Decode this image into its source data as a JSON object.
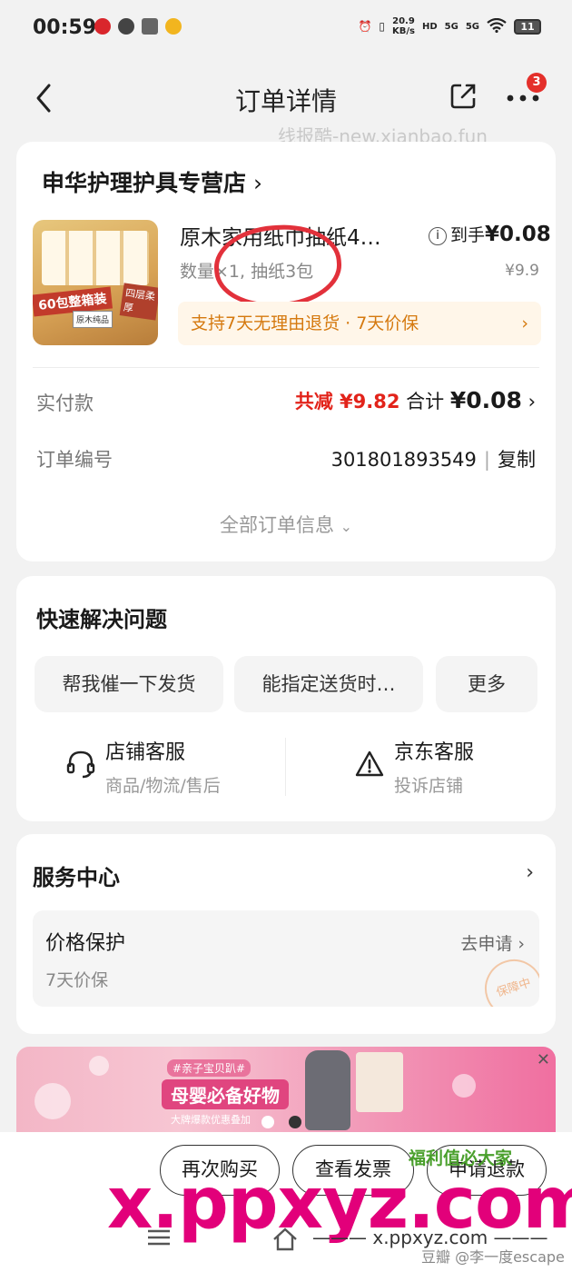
{
  "status_bar": {
    "time": "00:59",
    "net_speed": "20.9\nKB/s",
    "hd": "HD",
    "sig1": "5G",
    "sig2": "5G",
    "battery": "11"
  },
  "nav": {
    "title": "订单详情",
    "badge_count": "3"
  },
  "top_watermark": "线报酷-new.xianbao.fun",
  "order": {
    "store_name": "申华护理护具专营店",
    "product_name": "原木家用纸巾抽纸4…",
    "product_spec": "数量×1, 抽纸3包",
    "image_text": {
      "tag": "60包整箱装",
      "tag2": "四层柔厚",
      "logo": "原木纯品"
    },
    "price_label": "到手",
    "price_final": "¥0.08",
    "price_orig": "¥9.9",
    "promise": "支持7天无理由退货 · 7天价保",
    "pay_label": "实付款",
    "reduce": "共减 ¥9.82",
    "total_label": "合计",
    "total": "¥0.08",
    "order_no_label": "订单编号",
    "order_no": "301801893549",
    "copy": "复制",
    "all_info": "全部订单信息"
  },
  "quick": {
    "title": "快速解决问题",
    "buttons": [
      "帮我催一下发货",
      "能指定送货时…",
      "更多"
    ],
    "store_cs": {
      "title": "店铺客服",
      "sub": "商品/物流/售后"
    },
    "jd_cs": {
      "title": "京东客服",
      "sub": "投诉店铺"
    }
  },
  "service": {
    "title": "服务中心",
    "item_title": "价格保护",
    "item_sub": "7天价保",
    "item_action": "去申请",
    "stamp": "保障中"
  },
  "banner": {
    "tag": "#亲子宝贝趴#",
    "title": "母婴必备好物",
    "sub": "大牌爆款优惠叠加"
  },
  "bottom": {
    "buy_again": "再次购买",
    "invoice": "查看发票",
    "refund": "申请退款",
    "logo_text": "福利值必大家"
  },
  "watermarks": {
    "big": "x.ppxyz.com",
    "url": "——— x.ppxyz.com ———",
    "user": "豆瓣 @李一度escape"
  },
  "colors": {
    "accent_red": "#e2231a",
    "promise_orange": "#d5790f",
    "circle_red": "#e2313b"
  }
}
